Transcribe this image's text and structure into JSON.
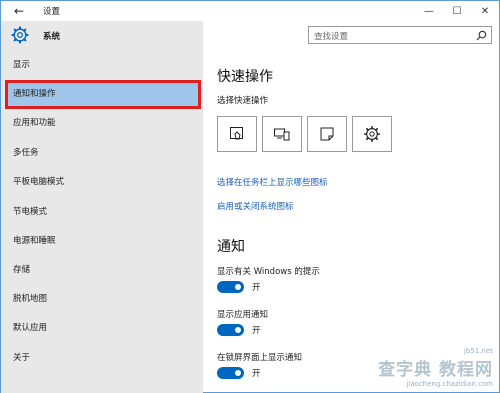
{
  "window": {
    "title": "设置"
  },
  "controls": {
    "back": "←",
    "minimize": "—",
    "maximize": "☐",
    "close": "✕"
  },
  "sidebar": {
    "header_label": "系统",
    "items": [
      {
        "label": "显示"
      },
      {
        "label": "通知和操作",
        "selected": true
      },
      {
        "label": "应用和功能"
      },
      {
        "label": "多任务"
      },
      {
        "label": "平板电脑模式"
      },
      {
        "label": "节电模式"
      },
      {
        "label": "电源和睡眠"
      },
      {
        "label": "存储"
      },
      {
        "label": "脱机地图"
      },
      {
        "label": "默认应用"
      },
      {
        "label": "关于"
      }
    ]
  },
  "search": {
    "placeholder": "查找设置"
  },
  "main": {
    "quick_actions_title": "快速操作",
    "quick_actions_subtitle": "选择快速操作",
    "quick_action_icons": [
      "tablet-mode-icon",
      "connect-icon",
      "note-icon",
      "settings-icon"
    ],
    "link_taskbar_icons": "选择在任务栏上显示哪些图标",
    "link_system_icons": "启用或关闭系统图标",
    "notifications_title": "通知",
    "settings": [
      {
        "label": "显示有关 Windows 的提示",
        "state": "开",
        "on": true
      },
      {
        "label": "显示应用通知",
        "state": "开",
        "on": true
      },
      {
        "label": "在锁屏界面上显示通知",
        "state": "开",
        "on": true
      }
    ]
  },
  "watermark": {
    "text": "查字典 教程网",
    "url": "jiaocheng.chazidian.com",
    "site": "jb51.net"
  },
  "colors": {
    "accent": "#0067c0",
    "selection": "#9fc6ea",
    "highlight_border": "#e0201c",
    "sidebar_bg": "#e8e8e8"
  }
}
